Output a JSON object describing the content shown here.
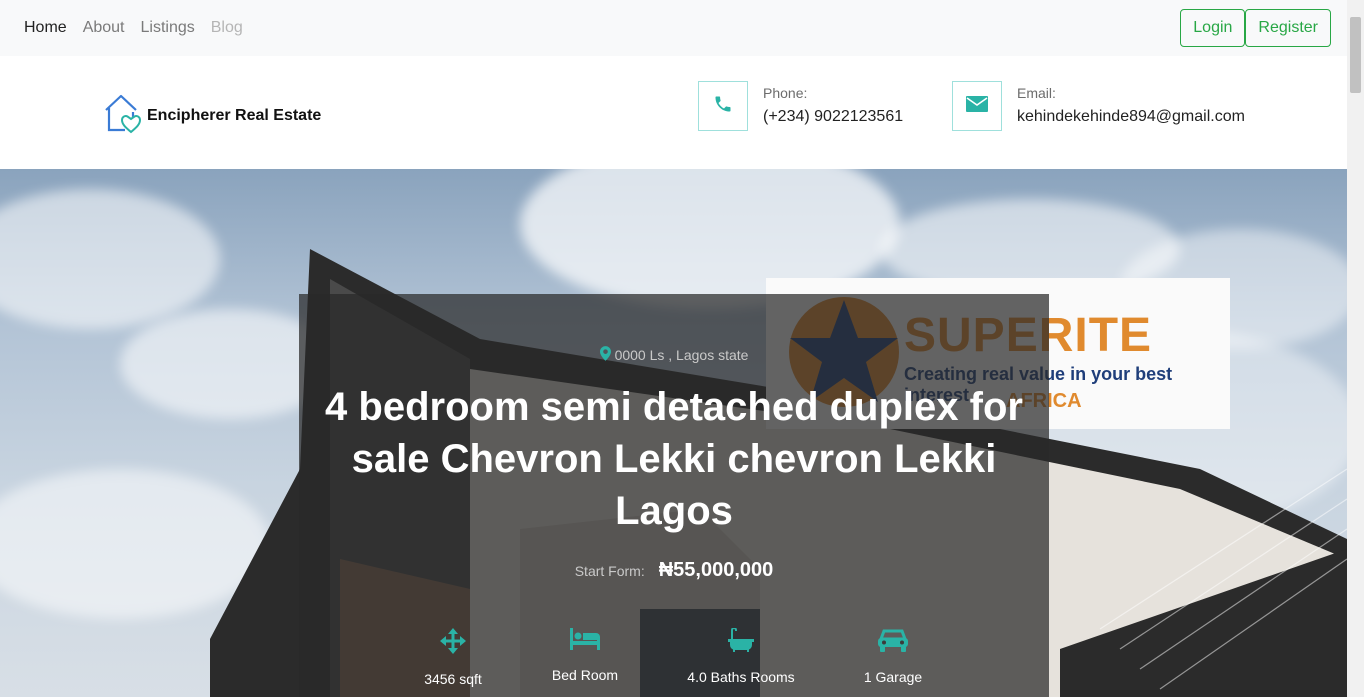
{
  "nav": {
    "links": [
      {
        "label": "Home",
        "state": "active"
      },
      {
        "label": "About",
        "state": "normal"
      },
      {
        "label": "Listings",
        "state": "normal"
      },
      {
        "label": "Blog",
        "state": "disabled"
      }
    ],
    "login_label": "Login",
    "register_label": "Register"
  },
  "header": {
    "brand_name": "Encipherer Real Estate",
    "phone_label": "Phone:",
    "phone_value": "(+234) 9022123561",
    "email_label": "Email:",
    "email_value": "kehindekehinde894@gmail.com"
  },
  "hero": {
    "location": "0000 Ls , Lagos state",
    "title": "4 bedroom semi detached duplex for sale Chevron Lekki chevron Lekki Lagos",
    "price_label": "Start Form:",
    "price": "₦55,000,000",
    "sign_brand": "SUPERITE",
    "sign_tagline": "Creating real value in your best interest",
    "sign_region": "AFRICA",
    "features": [
      {
        "icon": "arrows-alt-icon",
        "label": "3456 sqft"
      },
      {
        "icon": "bed-icon",
        "label": "Bed Room"
      },
      {
        "icon": "bath-icon",
        "label": "4.0 Baths Rooms"
      },
      {
        "icon": "car-icon",
        "label": "1 Garage"
      }
    ]
  },
  "colors": {
    "accent": "#2ab3a6",
    "success": "#28a745",
    "overlay": "#282828"
  }
}
